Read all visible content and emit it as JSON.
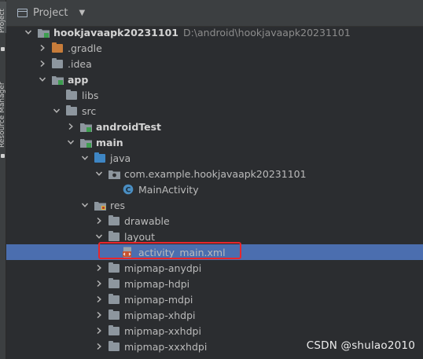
{
  "side_tabs": {
    "project": "Project",
    "resource_manager": "Resource Manager"
  },
  "header": {
    "title": "Project"
  },
  "tree": [
    {
      "label": "hookjavaapk20231101",
      "path": "D:\\android\\hookjavaapk20231101",
      "indent": 0,
      "expand": "open",
      "icon": "module",
      "bold": true
    },
    {
      "label": ".gradle",
      "indent": 1,
      "expand": "closed",
      "icon": "folder-orange"
    },
    {
      "label": ".idea",
      "indent": 1,
      "expand": "closed",
      "icon": "folder"
    },
    {
      "label": "app",
      "indent": 1,
      "expand": "open",
      "icon": "module",
      "bold": true
    },
    {
      "label": "libs",
      "indent": 2,
      "expand": "none",
      "icon": "folder"
    },
    {
      "label": "src",
      "indent": 2,
      "expand": "open",
      "icon": "folder"
    },
    {
      "label": "androidTest",
      "indent": 3,
      "expand": "closed",
      "icon": "module",
      "bold": true
    },
    {
      "label": "main",
      "indent": 3,
      "expand": "open",
      "icon": "module",
      "bold": true
    },
    {
      "label": "java",
      "indent": 4,
      "expand": "open",
      "icon": "folder-blue"
    },
    {
      "label": "com.example.hookjavaapk20231101",
      "indent": 5,
      "expand": "open",
      "icon": "package"
    },
    {
      "label": "MainActivity",
      "indent": 6,
      "expand": "none",
      "icon": "class"
    },
    {
      "label": "res",
      "indent": 4,
      "expand": "open",
      "icon": "folder-res"
    },
    {
      "label": "drawable",
      "indent": 5,
      "expand": "closed",
      "icon": "folder"
    },
    {
      "label": "layout",
      "indent": 5,
      "expand": "open",
      "icon": "folder"
    },
    {
      "label": "activity_main.xml",
      "indent": 6,
      "expand": "none",
      "icon": "xml",
      "selected": true
    },
    {
      "label": "mipmap-anydpi",
      "indent": 5,
      "expand": "closed",
      "icon": "folder"
    },
    {
      "label": "mipmap-hdpi",
      "indent": 5,
      "expand": "closed",
      "icon": "folder"
    },
    {
      "label": "mipmap-mdpi",
      "indent": 5,
      "expand": "closed",
      "icon": "folder"
    },
    {
      "label": "mipmap-xhdpi",
      "indent": 5,
      "expand": "closed",
      "icon": "folder"
    },
    {
      "label": "mipmap-xxhdpi",
      "indent": 5,
      "expand": "closed",
      "icon": "folder"
    },
    {
      "label": "mipmap-xxxhdpi",
      "indent": 5,
      "expand": "closed",
      "icon": "folder"
    }
  ],
  "colors": {
    "selection": "#4b6eaf",
    "highlight_box": "#e8262b"
  },
  "watermark": "CSDN @shulao2010"
}
